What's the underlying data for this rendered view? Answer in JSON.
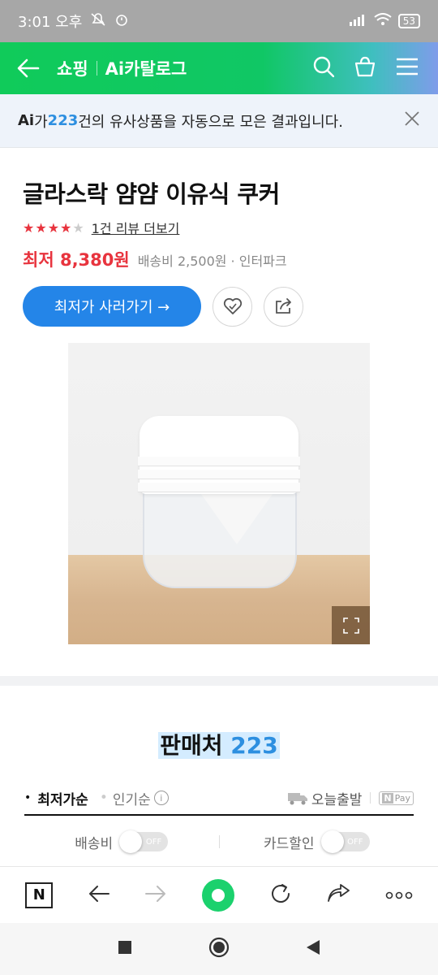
{
  "status_bar": {
    "time": "3:01 오후",
    "battery": "53"
  },
  "header": {
    "section": "쇼핑",
    "service": "Ai카탈로그"
  },
  "banner": {
    "prefix": "Ai",
    "text_before": "가 ",
    "count": "223",
    "text_after": "건의 유사상품을 자동으로 모은 결과입니다."
  },
  "product": {
    "name": "글라스락 얌얌 이유식 쿠커",
    "rating_stars": 4,
    "review_link": "1건 리뷰 더보기",
    "price": "최저 8,380원",
    "shipping": "배송비 2,500원 · 인터파크",
    "buy_button": "최저가 사러가기 →"
  },
  "sellers": {
    "title": "판매처",
    "count": "223",
    "sort_active": "최저가순",
    "sort_popular": "인기순",
    "today_ship": "오늘출발",
    "npay": "Pay",
    "filter_shipping": "배송비",
    "filter_card": "카드할인",
    "toggle_off": "OFF"
  },
  "colors": {
    "brand_green": "#10cb5a",
    "accent_blue": "#2485e8",
    "price_red": "#e8343e"
  },
  "icons": [
    "back-arrow-icon",
    "search-icon",
    "cart-icon",
    "menu-icon",
    "close-icon",
    "heart-icon",
    "share-icon",
    "expand-icon",
    "truck-icon",
    "info-icon"
  ]
}
